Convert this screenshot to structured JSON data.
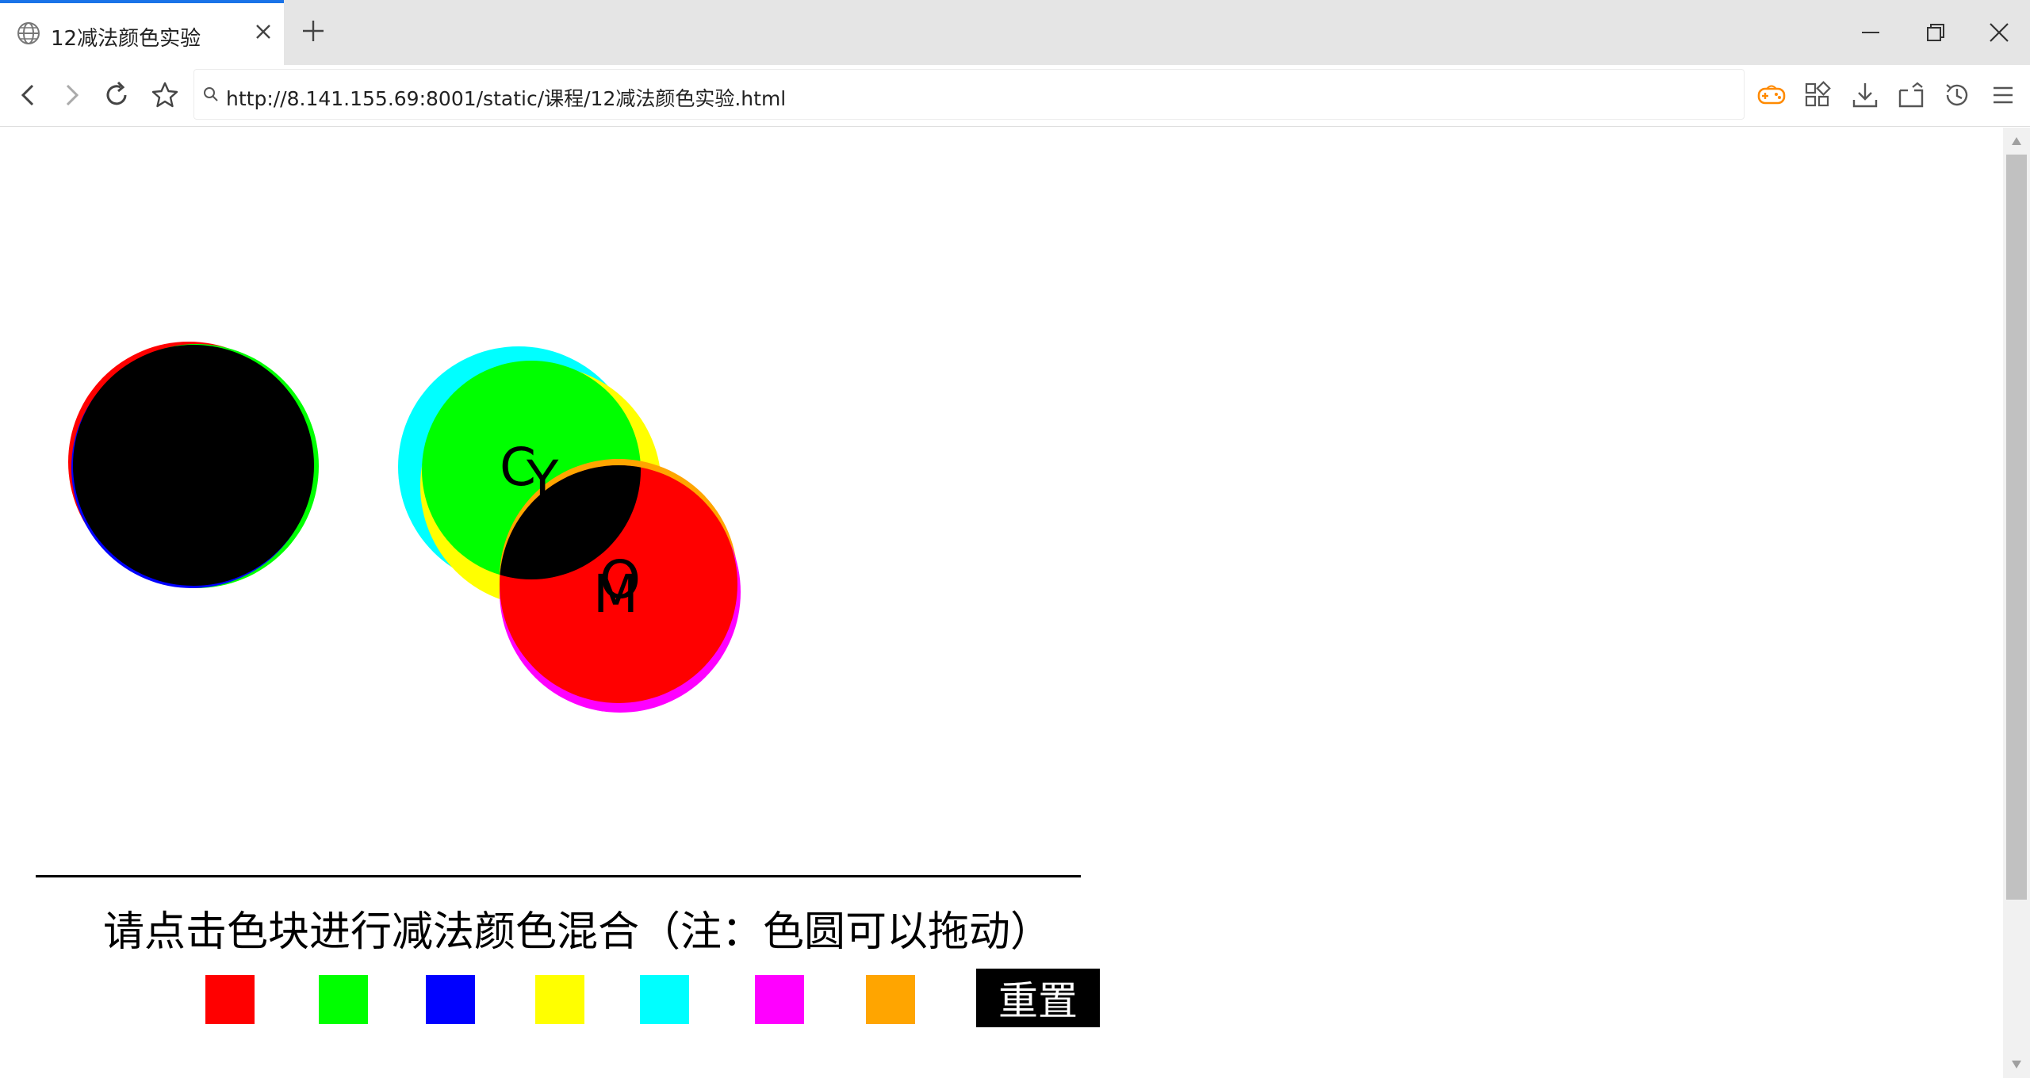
{
  "tab": {
    "title": "12减法颜色实验"
  },
  "address_bar": {
    "url": "http://8.141.155.69:8001/static/课程/12减法颜色实验.html"
  },
  "page": {
    "circles": [
      {
        "label": "",
        "color": "#ff0000"
      },
      {
        "label": "",
        "color": "#00ff00"
      },
      {
        "label": "",
        "color": "#0000ff"
      },
      {
        "label": "",
        "color": "#000000"
      },
      {
        "label": "C",
        "color": "#00ffff"
      },
      {
        "label": "Y",
        "color": "#ffff00"
      },
      {
        "label": "",
        "color": "#00ff00"
      },
      {
        "label": "O",
        "color": "#ffa500"
      },
      {
        "label": "M",
        "color": "#ff00ff"
      },
      {
        "label": "",
        "color": "#ff0000"
      }
    ],
    "instruction": "请点击色块进行减法颜色混合（注：色圆可以拖动）",
    "swatches": [
      {
        "name": "red",
        "color": "#ff0000"
      },
      {
        "name": "green",
        "color": "#00ff00"
      },
      {
        "name": "blue",
        "color": "#0000ff"
      },
      {
        "name": "yellow",
        "color": "#ffff00"
      },
      {
        "name": "cyan",
        "color": "#00ffff"
      },
      {
        "name": "magenta",
        "color": "#ff00ff"
      },
      {
        "name": "orange",
        "color": "#ffa500"
      }
    ],
    "reset_label": "重置"
  }
}
